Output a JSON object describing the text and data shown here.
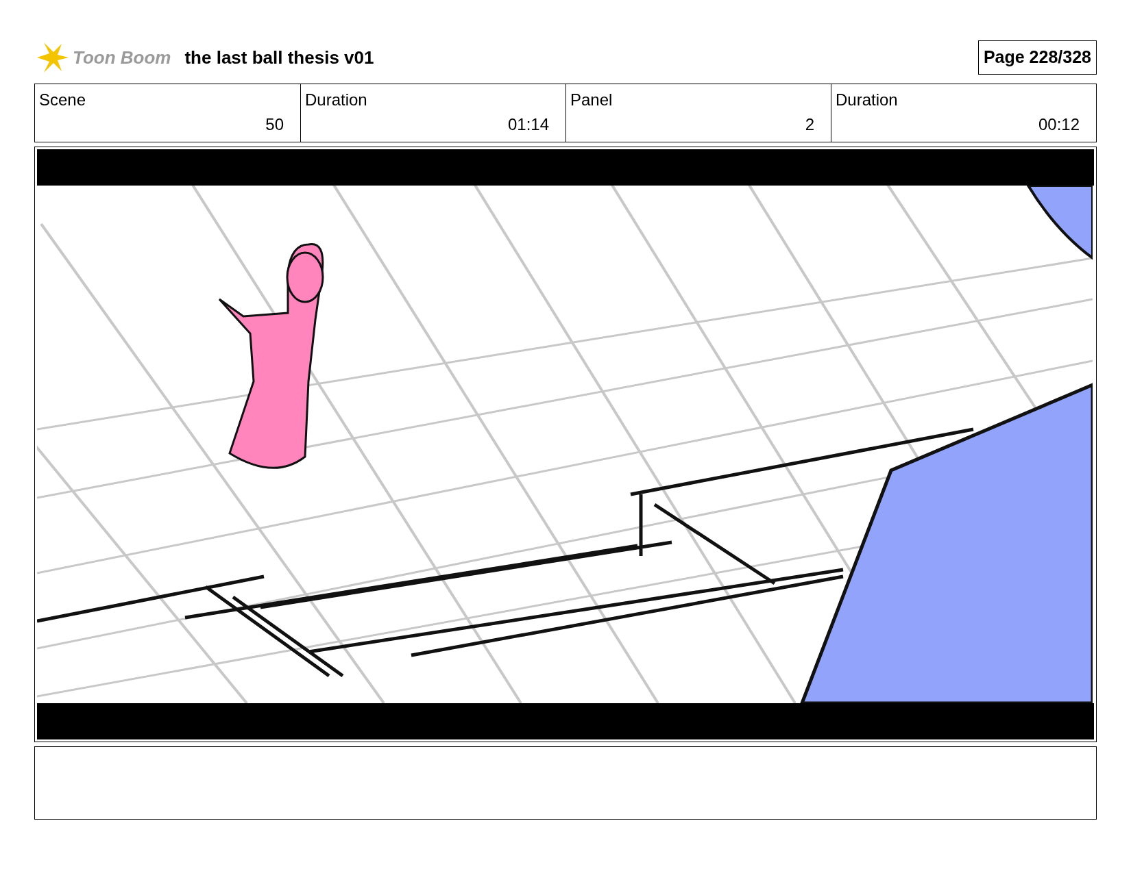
{
  "header": {
    "logo_text": "Toon Boom",
    "title": "the last ball thesis v01",
    "page": "Page 228/328"
  },
  "fields": [
    {
      "label": "Scene",
      "value": "50"
    },
    {
      "label": "Duration",
      "value": "01:14"
    },
    {
      "label": "Panel",
      "value": "2"
    },
    {
      "label": "Duration",
      "value": "00:12"
    }
  ]
}
